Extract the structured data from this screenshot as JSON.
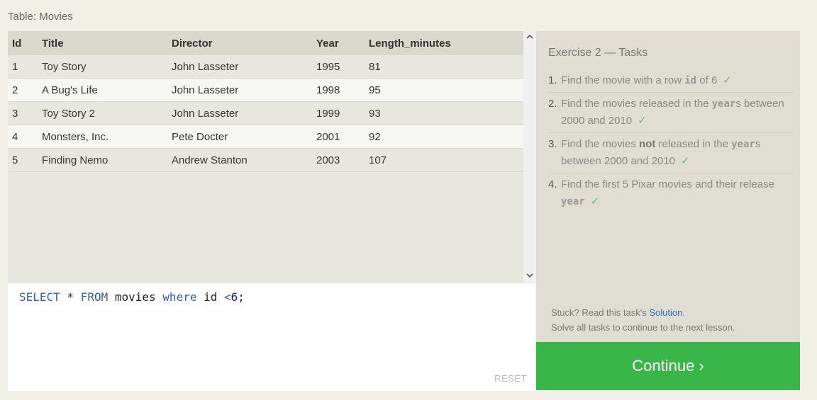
{
  "table_caption": "Table: Movies",
  "table": {
    "headers": [
      "Id",
      "Title",
      "Director",
      "Year",
      "Length_minutes"
    ],
    "rows": [
      [
        "1",
        "Toy Story",
        "John Lasseter",
        "1995",
        "81"
      ],
      [
        "2",
        "A Bug's Life",
        "John Lasseter",
        "1998",
        "95"
      ],
      [
        "3",
        "Toy Story 2",
        "John Lasseter",
        "1999",
        "93"
      ],
      [
        "4",
        "Monsters, Inc.",
        "Pete Docter",
        "2001",
        "92"
      ],
      [
        "5",
        "Finding Nemo",
        "Andrew Stanton",
        "2003",
        "107"
      ]
    ]
  },
  "editor": {
    "query": {
      "select": "SELECT",
      "star": " * ",
      "from": "FROM",
      "table": " movies ",
      "where": "where",
      "col": " id ",
      "op": "<",
      "num": "6",
      "end": ";"
    },
    "reset_label": "RESET"
  },
  "tasks": {
    "title": "Exercise 2 — Tasks",
    "items": [
      {
        "num": "1.",
        "before": "Find the movie with a row ",
        "code": "id",
        "after": " of 6"
      },
      {
        "num": "2.",
        "before": "Find the movies released in the ",
        "code": "year",
        "after": "s between 2000 and 2010"
      },
      {
        "num": "3.",
        "before": "Find the movies ",
        "bold": "not",
        "mid": " released in the ",
        "code": "year",
        "after": "s between 2000 and 2010"
      },
      {
        "num": "4.",
        "before": "Find the first 5 Pixar movies and their release ",
        "code": "year",
        "after": ""
      }
    ],
    "check": "✓",
    "stuck_text": "Stuck? Read this task's ",
    "solution_link": "Solution",
    "stuck_end": ".",
    "solve_all": "Solve all tasks to continue to the next lesson."
  },
  "continue_label": "Continue ›",
  "colors": {
    "continue_bg": "#3ab54a",
    "link": "#2d6cc0",
    "check": "#6bbf6b"
  }
}
